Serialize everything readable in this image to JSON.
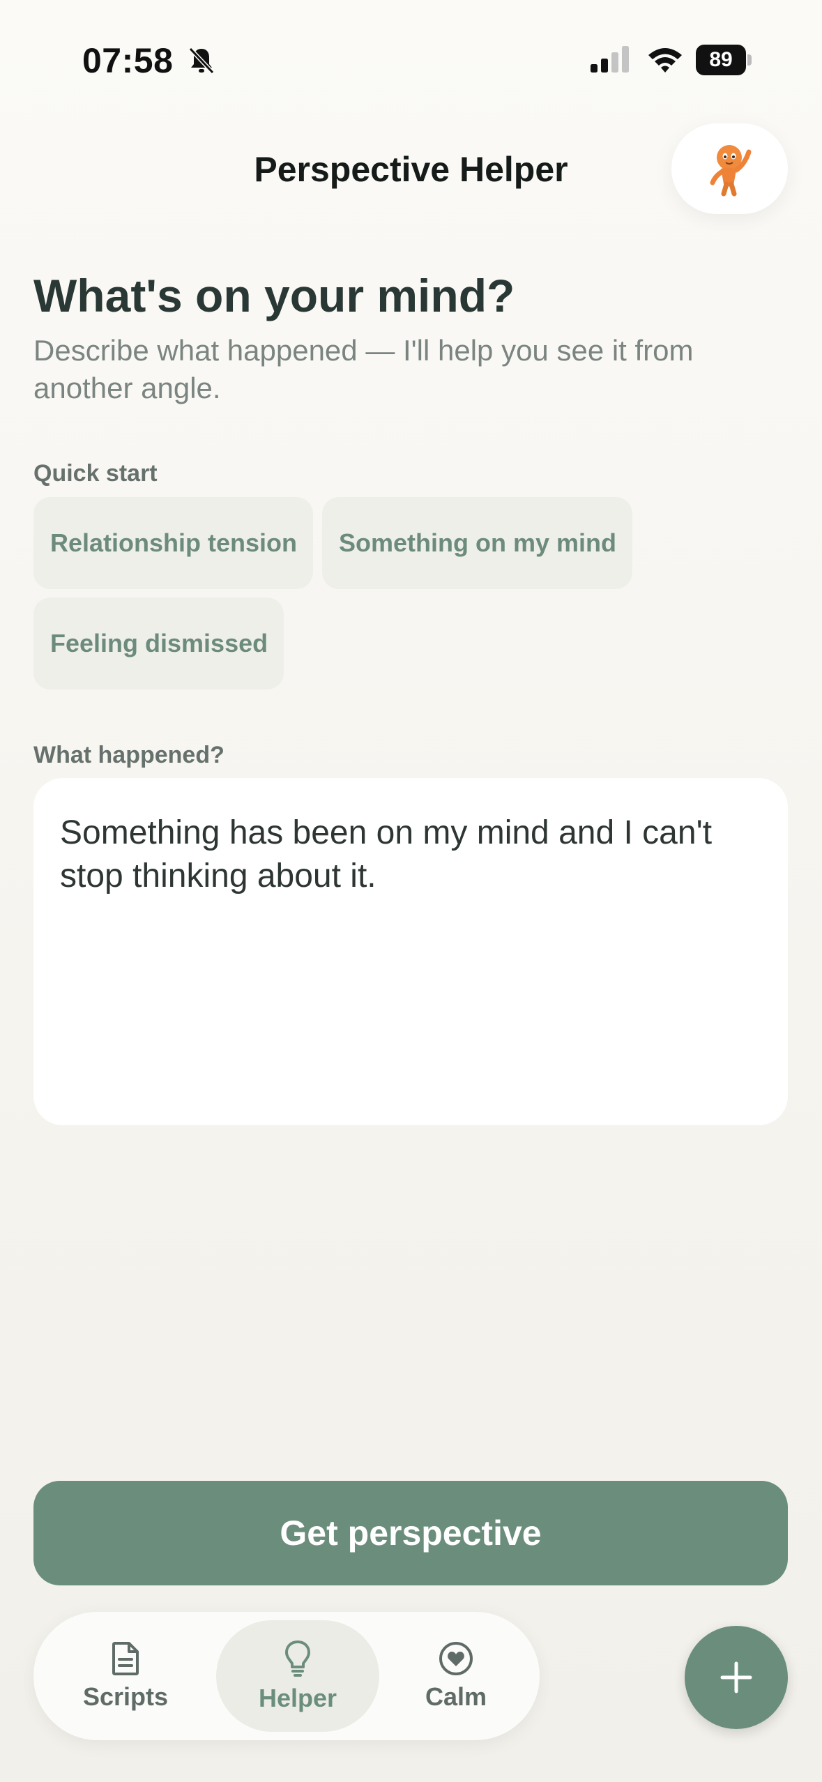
{
  "status_bar": {
    "time": "07:58",
    "battery": "89",
    "icons": [
      "bell-slash-icon",
      "signal-icon",
      "wifi-icon",
      "battery-icon"
    ]
  },
  "header": {
    "title": "Perspective Helper",
    "mascot_icon": "mascot-avatar"
  },
  "main": {
    "title": "What's on your mind?",
    "subtitle": "Describe what happened — I'll help you see it from another angle.",
    "quick_start_label": "Quick start",
    "quick_start_chips": [
      "Relationship tension",
      "Something on my mind",
      "Feeling dismissed"
    ],
    "input_label": "What happened?",
    "input_value": "Something has been on my mind and I can't stop thinking about it.",
    "cta_label": "Get perspective"
  },
  "tab_bar": {
    "tabs": [
      {
        "label": "Scripts",
        "icon": "document-icon"
      },
      {
        "label": "Helper",
        "icon": "lightbulb-icon",
        "active": true
      },
      {
        "label": "Calm",
        "icon": "heart-circle-icon"
      }
    ],
    "fab_icon": "plus-icon"
  },
  "colors": {
    "accent": "#6b8e7c",
    "chip_bg": "#efefea",
    "background": "#f6f4ef"
  }
}
